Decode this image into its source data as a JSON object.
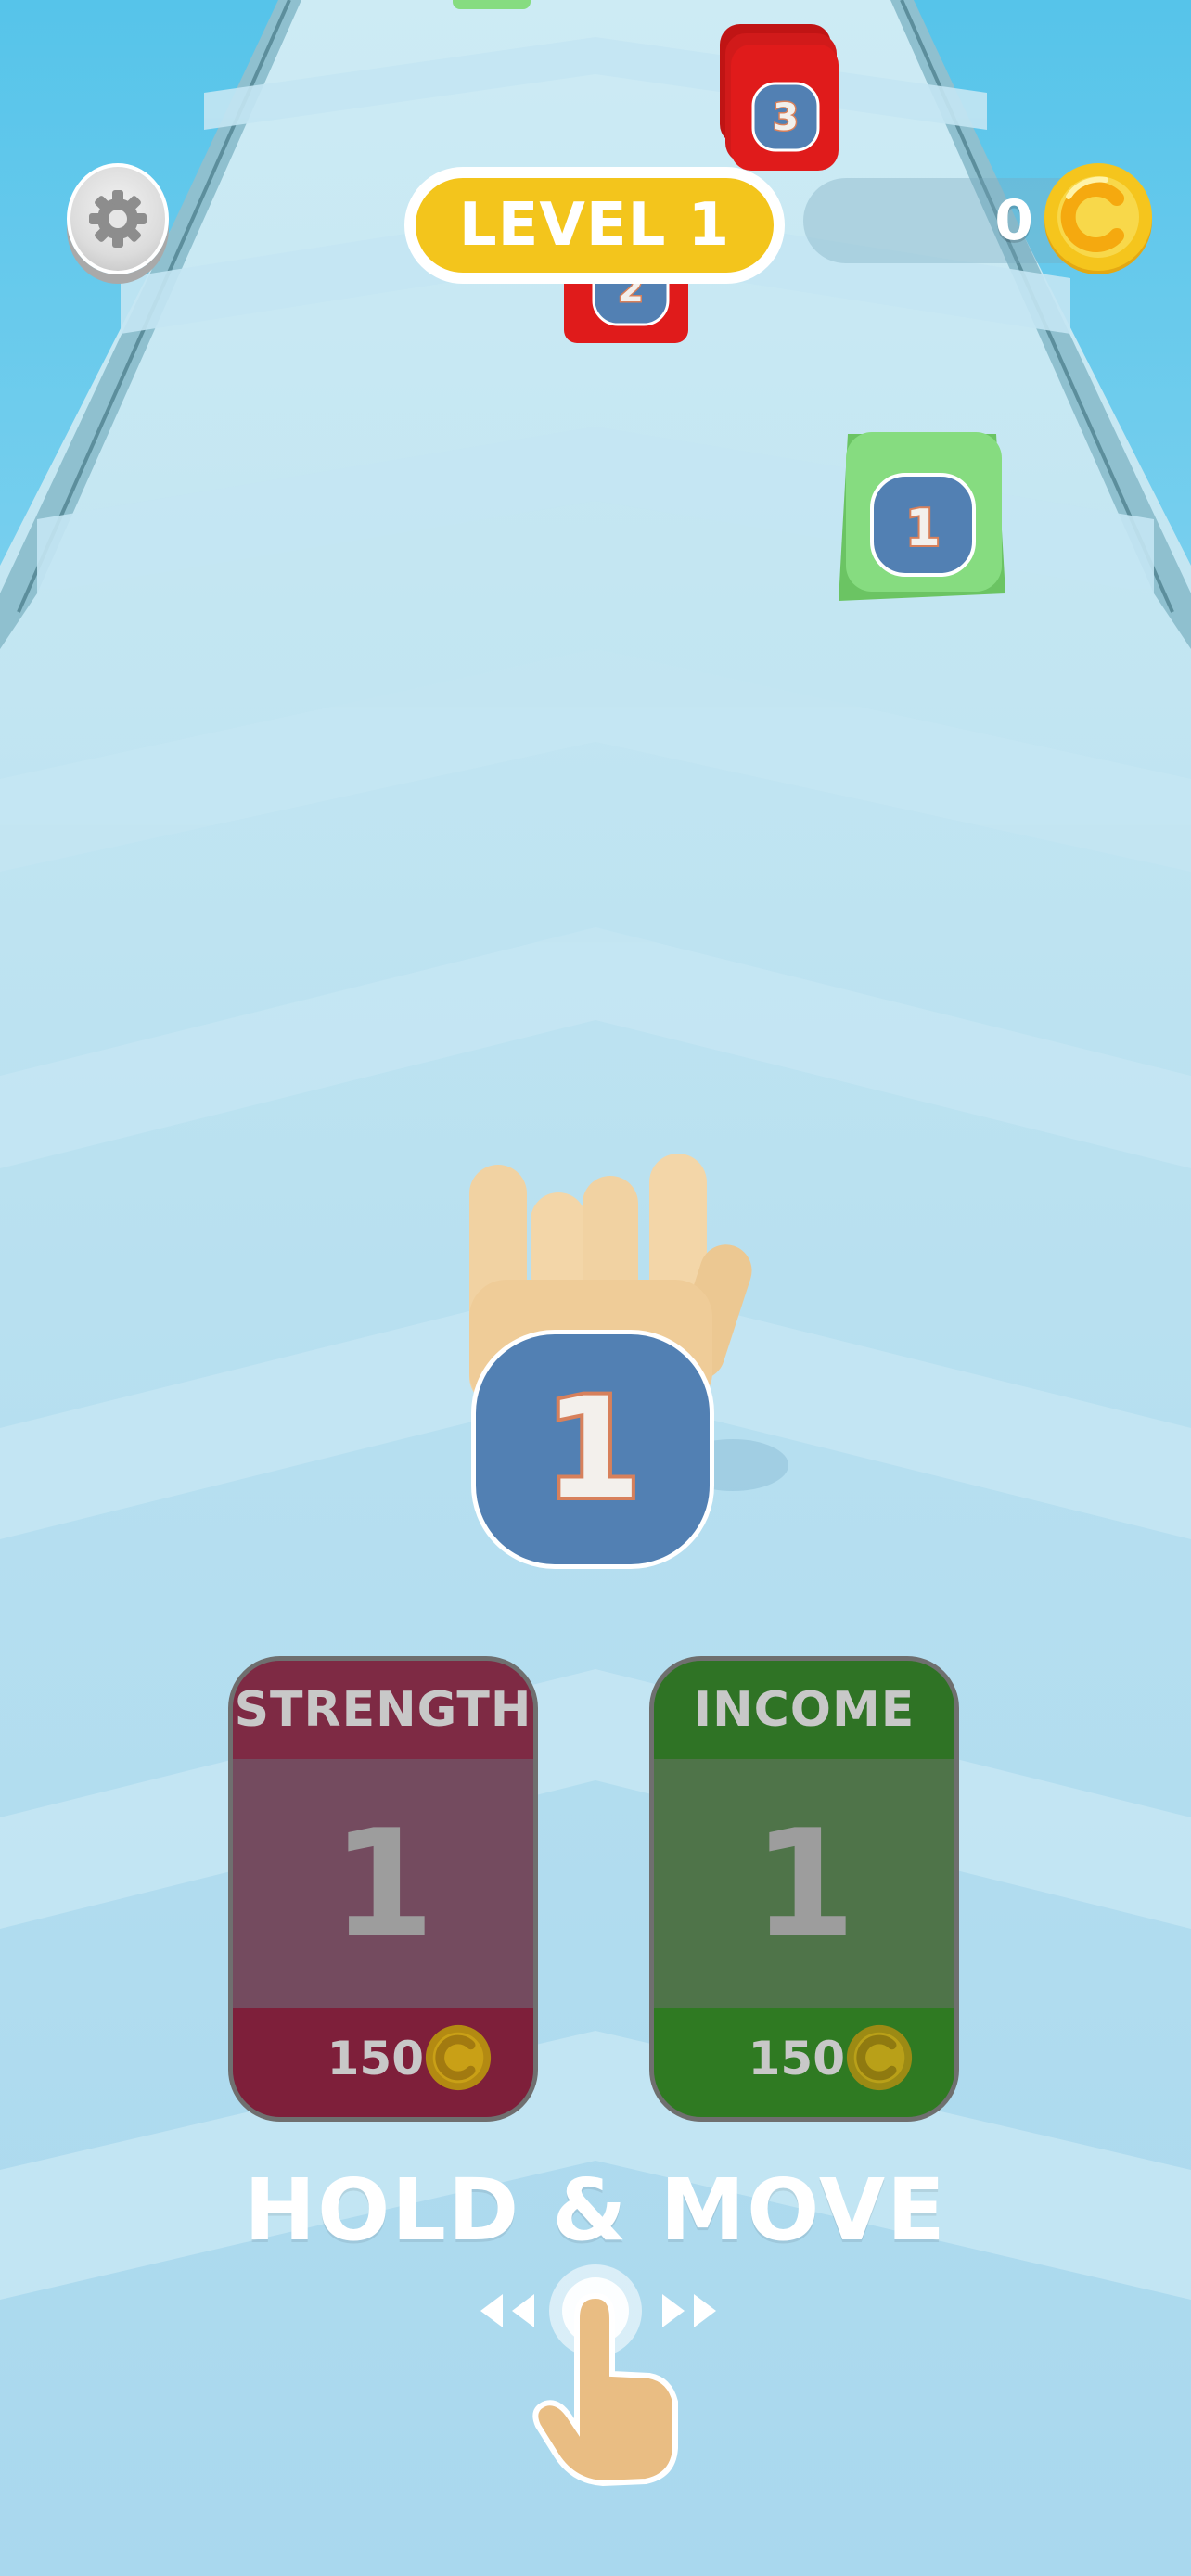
{
  "hud": {
    "level_label": "LEVEL 1",
    "coin_count": "0",
    "settings_icon": "gear-icon",
    "coin_icon": "coin-icon"
  },
  "track_obstacles": [
    {
      "type": "red-stack",
      "number": "3"
    },
    {
      "type": "red-block",
      "number": "2"
    },
    {
      "type": "green-block",
      "number": "1"
    },
    {
      "type": "green-block",
      "number": ""
    }
  ],
  "player": {
    "number": "1"
  },
  "upgrades": {
    "strength": {
      "title": "STRENGTH",
      "level": "1",
      "price": "150"
    },
    "income": {
      "title": "INCOME",
      "level": "1",
      "price": "150"
    }
  },
  "instruction": {
    "text": "HOLD & MOVE"
  },
  "colors": {
    "sky": "#57c5ea",
    "track": "#bfe5f2",
    "level_pill": "#f3c51c",
    "strength_card": "#7e2a44",
    "income_card": "#2f7325",
    "obstacle_red": "#e01b1b",
    "obstacle_green": "#86dc80",
    "badge_blue": "#5280b3"
  }
}
